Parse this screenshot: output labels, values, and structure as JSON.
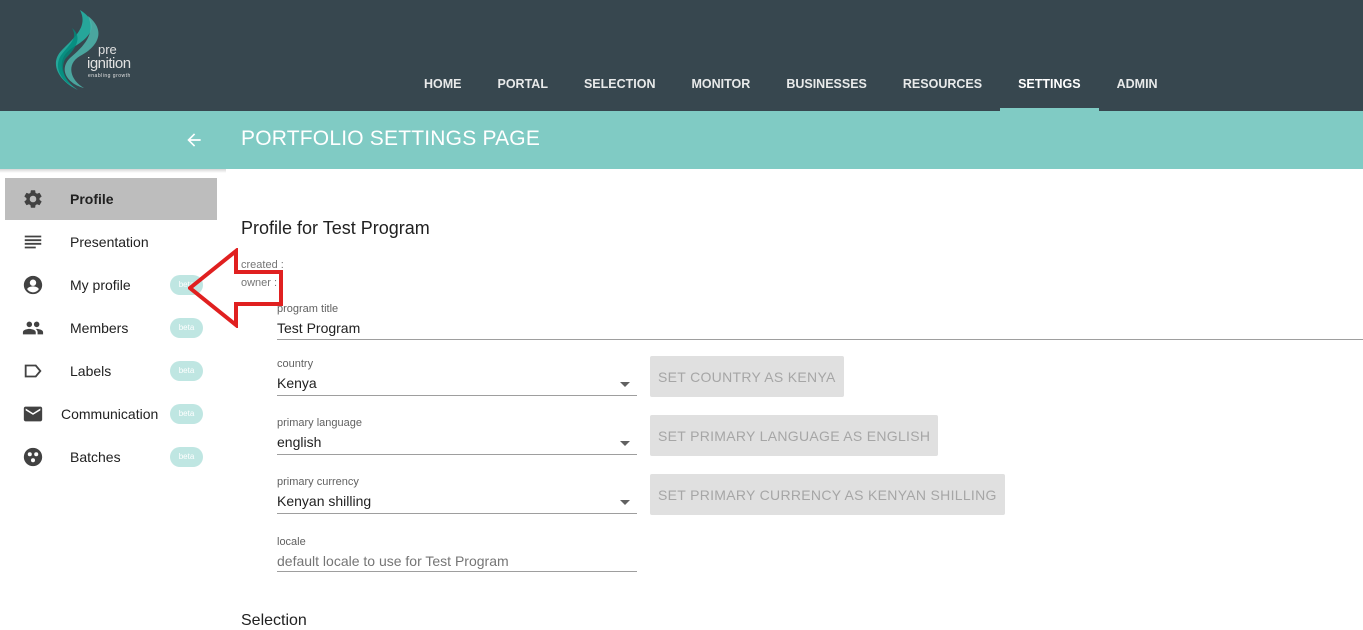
{
  "logo": {
    "line1": "pre",
    "line2": "ignition",
    "tagline": "enabling growth"
  },
  "nav": [
    {
      "label": "HOME"
    },
    {
      "label": "PORTAL"
    },
    {
      "label": "SELECTION"
    },
    {
      "label": "MONITOR"
    },
    {
      "label": "BUSINESSES"
    },
    {
      "label": "RESOURCES"
    },
    {
      "label": "SETTINGS",
      "active": true
    },
    {
      "label": "ADMIN"
    }
  ],
  "header": {
    "title": "PORTFOLIO SETTINGS PAGE",
    "back_icon": "arrow-left-icon"
  },
  "sidebar": {
    "items": [
      {
        "label": "Profile",
        "icon": "gear-icon",
        "active": true
      },
      {
        "label": "Presentation",
        "icon": "lines-icon"
      },
      {
        "label": "My profile",
        "icon": "account-circle-icon",
        "badge": "beta"
      },
      {
        "label": "Members",
        "icon": "people-icon",
        "badge": "beta"
      },
      {
        "label": "Labels",
        "icon": "label-icon",
        "badge": "beta"
      },
      {
        "label": "Communication",
        "icon": "mail-icon",
        "badge": "beta"
      },
      {
        "label": "Batches",
        "icon": "batches-icon",
        "badge": "beta"
      }
    ]
  },
  "main": {
    "section_title": "Profile for Test Program",
    "created_label": "created :",
    "owner_label": "owner :",
    "program_title": {
      "label": "program title",
      "value": "Test Program"
    },
    "country": {
      "label": "country",
      "value": "Kenya",
      "button": "SET COUNTRY AS KENYA"
    },
    "language": {
      "label": "primary language",
      "value": "english",
      "button": "SET PRIMARY LANGUAGE AS ENGLISH"
    },
    "currency": {
      "label": "primary currency",
      "value": "Kenyan shilling",
      "button": "SET PRIMARY CURRENCY AS KENYAN SHILLING"
    },
    "locale": {
      "label": "locale",
      "placeholder": "default locale to use for Test Program"
    },
    "next_section": "Selection"
  },
  "colors": {
    "topbar": "#37474f",
    "accent": "#80cbc4",
    "active_side": "#bdbdbd",
    "badge": "#bfe6e2",
    "annotation": "#e02020"
  }
}
